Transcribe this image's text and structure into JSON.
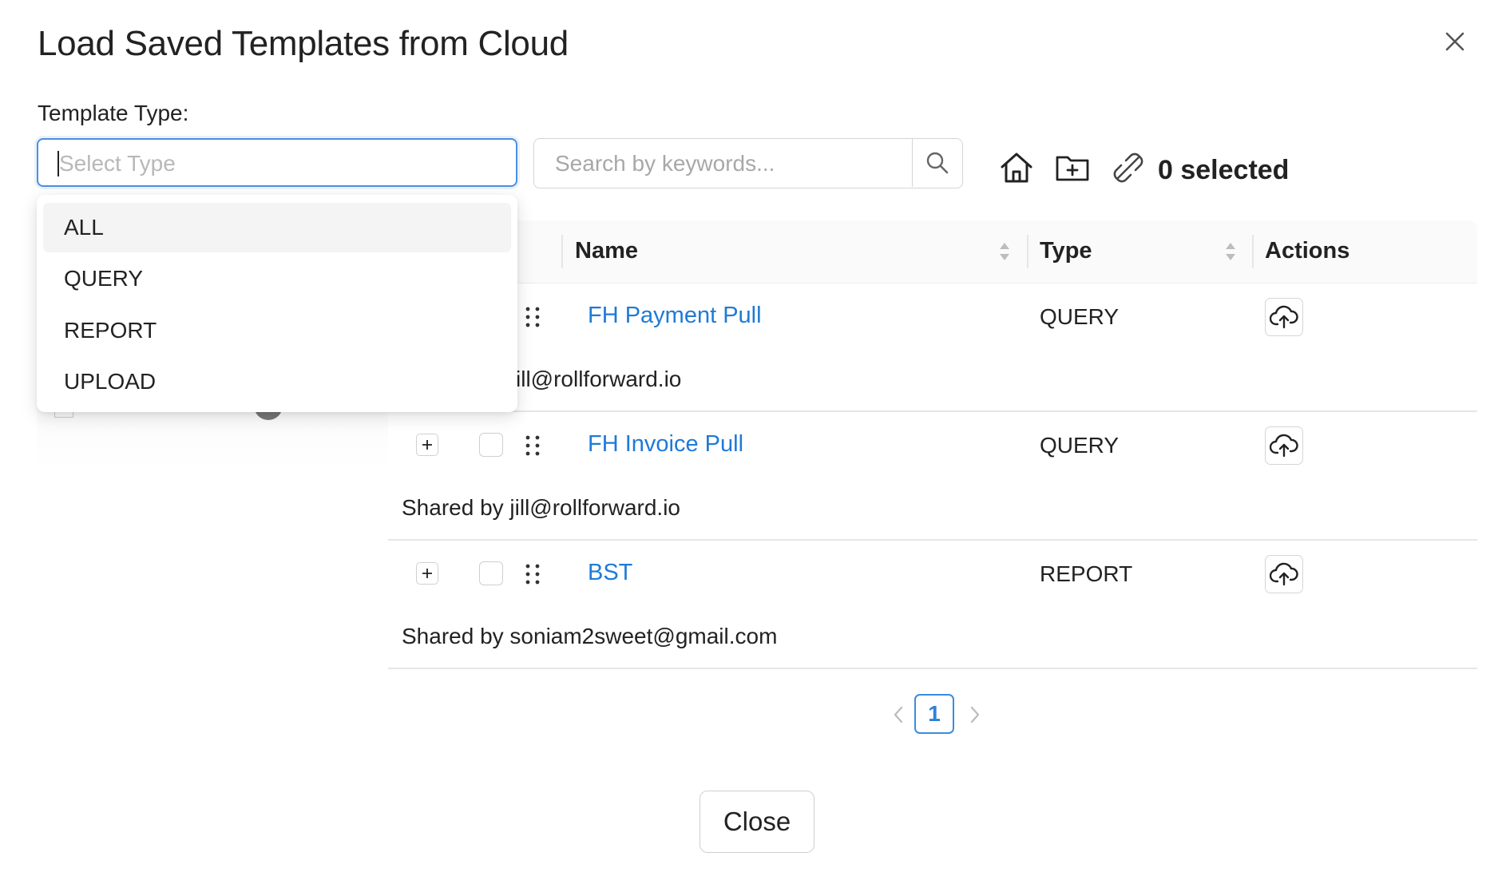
{
  "dialog": {
    "title": "Load Saved Templates from Cloud"
  },
  "filter": {
    "template_type_label": "Template Type:",
    "select_placeholder": "Select Type",
    "options": [
      "ALL",
      "QUERY",
      "REPORT",
      "UPLOAD"
    ],
    "highlighted_option": "ALL"
  },
  "search": {
    "placeholder": "Search by keywords..."
  },
  "toolbar": {
    "icons": [
      "home-icon",
      "folder-add-icon",
      "unlink-icon"
    ],
    "selected_count": "0 selected"
  },
  "table": {
    "columns": [
      "Name",
      "Type",
      "Actions"
    ],
    "rows": [
      {
        "name": "FH Payment Pull",
        "type": "QUERY",
        "shared": "Shared by jill@rollforward.io",
        "shared_visible": "ill@rollforward.io"
      },
      {
        "name": "FH Invoice Pull",
        "type": "QUERY",
        "shared": "Shared by jill@rollforward.io"
      },
      {
        "name": "BST",
        "type": "REPORT",
        "shared": "Shared by soniam2sweet@gmail.com"
      }
    ]
  },
  "pagination": {
    "current_page": "1"
  },
  "footer": {
    "close_label": "Close"
  },
  "colors": {
    "link": "#1e7ad8",
    "focus_border": "#4a90e2",
    "page_active": "#2f80db"
  }
}
